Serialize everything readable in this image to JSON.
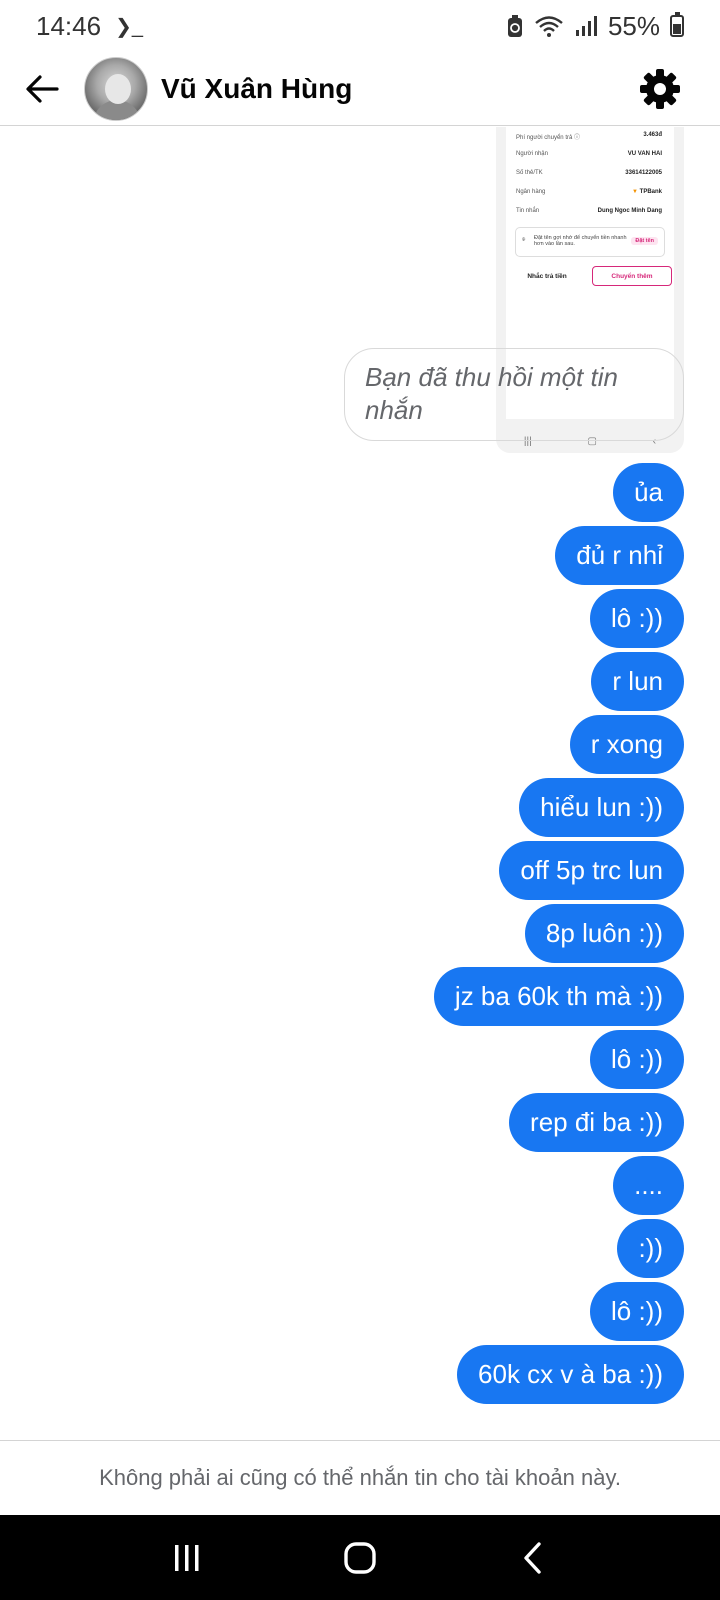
{
  "status_bar": {
    "time": "14:46",
    "terminal_glyph": "❯_",
    "battery": "55%",
    "battery_level": 0.55
  },
  "header": {
    "contact_name": "Vũ Xuân Hùng"
  },
  "receipt": {
    "rows": [
      {
        "label": "Phí người chuyển trả ⓘ",
        "value": "3.463đ"
      },
      {
        "label": "Người nhận",
        "value": "VU VAN HAI"
      },
      {
        "label": "Số thẻ/TK",
        "value": "33614122005"
      },
      {
        "label": "Ngân hàng",
        "value": "TPBank"
      },
      {
        "label": "Tin nhắn",
        "value": "Dung Ngoc Minh Dang"
      }
    ],
    "note": "Đặt tên gợi nhớ để chuyển tiền nhanh hơn vào lần sau.",
    "note_tag": "Đặt tên",
    "button_remind": "Nhắc trả tiền",
    "button_transfer_more": "Chuyển thêm"
  },
  "recalled_message": "Bạn đã thu hồi một tin nhắn",
  "messages": [
    "ủa",
    "đủ r nhỉ",
    "lô :))",
    "r lun",
    "r xong",
    "hiểu lun :))",
    "off 5p trc lun",
    "8p luôn :))",
    "jz ba 60k th mà :))",
    "lô :))",
    "rep đi ba :))",
    "....",
    ":))",
    "lô :))",
    "60k cx v à ba :))"
  ],
  "footer": {
    "notice": "Không phải ai cũng có thể nhắn tin cho tài khoản này."
  },
  "colors": {
    "bubble": "#1877f2",
    "navbar": "#000000",
    "transfer_accent": "#d6287a"
  }
}
